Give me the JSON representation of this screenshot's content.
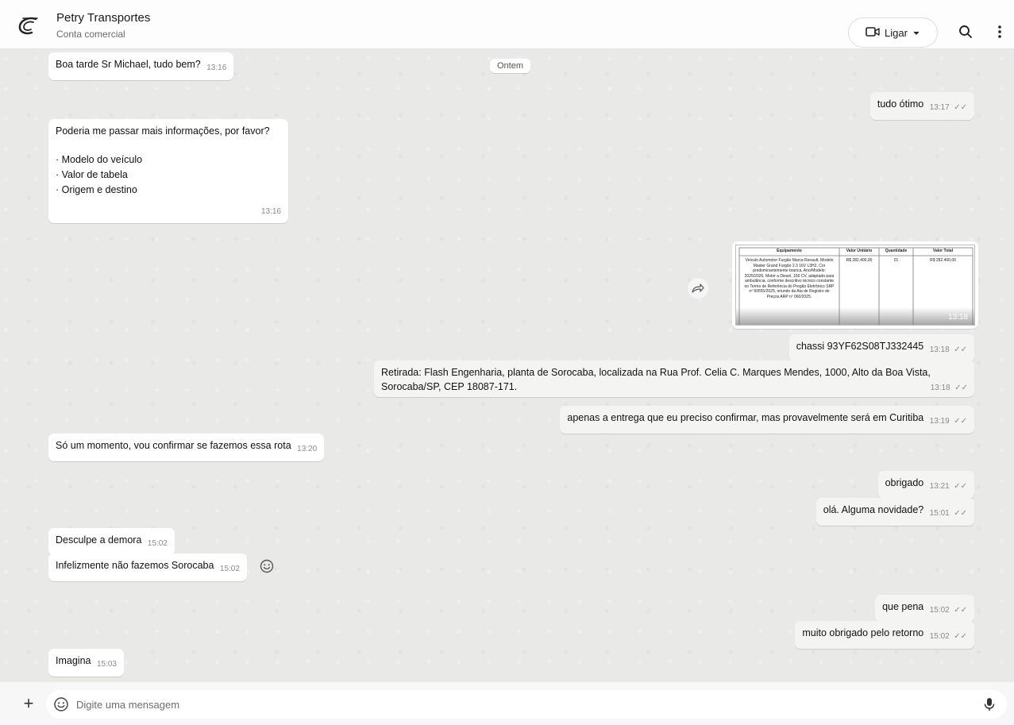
{
  "header": {
    "contact_name": "Petry Transportes",
    "contact_subtitle": "Conta comercial",
    "call_label": "Ligar"
  },
  "date_separator": "Ontem",
  "messages": [
    {
      "dir": "in",
      "text": "Boa tarde Sr Michael, tudo bem?",
      "time": "13:16"
    },
    {
      "dir": "out",
      "text": "tudo ótimo",
      "time": "13:17"
    },
    {
      "dir": "in",
      "text": "Poderia me passar mais informações, por favor?",
      "items": [
        "Modelo do veículo",
        "Valor de tabela",
        "Origem e destino"
      ],
      "time": "13:16"
    },
    {
      "dir": "out",
      "type": "image",
      "time": "13:18",
      "table_headers": [
        "Equipamento",
        "Valor Unitário",
        "Quantidade",
        "Valor Total"
      ],
      "table_row": [
        "Veículo Automotor Furgão Marca Renault, Modelo Master Grand Furgão 2.3 16V L3H2, Cor predominantemente branca, Ano/Modelo: 2025/2026, Motor a Diesel, 150 CV, adaptado para ambulância, conforme descritivo técnico constante no Termo de Referência do Pregão Eletrônico SRP nº 90555/2025, oriundo da Ata de Registro de Preços ARP nº 060/2025.",
        "R$ 282.400,00",
        "01",
        "R$ 282.400,00"
      ]
    },
    {
      "dir": "out",
      "text": "chassi 93YF62S08TJ332445",
      "time": "13:18"
    },
    {
      "dir": "out",
      "text": "Retirada: Flash Engenharia, planta de Sorocaba, localizada na Rua Prof. Celia C. Marques Mendes, 1000, Alto da Boa Vista,",
      "text2": "Sorocaba/SP, CEP 18087-171.",
      "time": "13:18"
    },
    {
      "dir": "out",
      "text": "apenas a entrega que eu preciso confirmar, mas provavelmente será em Curitiba",
      "time": "13:19"
    },
    {
      "dir": "in",
      "text": "Só um momento, vou confirmar se fazemos essa rota",
      "time": "13:20"
    },
    {
      "dir": "out",
      "text": "obrigado",
      "time": "13:21"
    },
    {
      "dir": "out",
      "text": "olá. Alguma novidade?",
      "time": "15:01"
    },
    {
      "dir": "in",
      "text": "Desculpe a demora",
      "time": "15:02"
    },
    {
      "dir": "in",
      "text": "Infelizmente não fazemos Sorocaba",
      "time": "15:02"
    },
    {
      "dir": "out",
      "text": "que pena",
      "time": "15:02"
    },
    {
      "dir": "out",
      "text": "muito obrigado pelo retorno",
      "time": "15:02"
    },
    {
      "dir": "in",
      "text": "Imagina",
      "time": "15:03"
    }
  ],
  "composer": {
    "placeholder": "Digite uma mensagem"
  },
  "ticks": "✓✓",
  "icons": {
    "logo": "petry-logo-icon",
    "call": "video-camera-icon",
    "search": "search-icon",
    "menu": "more-vertical-icon",
    "forward": "forward-icon",
    "reaction": "emoji-icon",
    "attach": "plus-icon",
    "emoji": "emoji-icon",
    "mic": "microphone-icon"
  },
  "colors": {
    "chat_background": "#e9e9e7",
    "bubble": "#ffffff",
    "header": "#fdfdfd"
  }
}
